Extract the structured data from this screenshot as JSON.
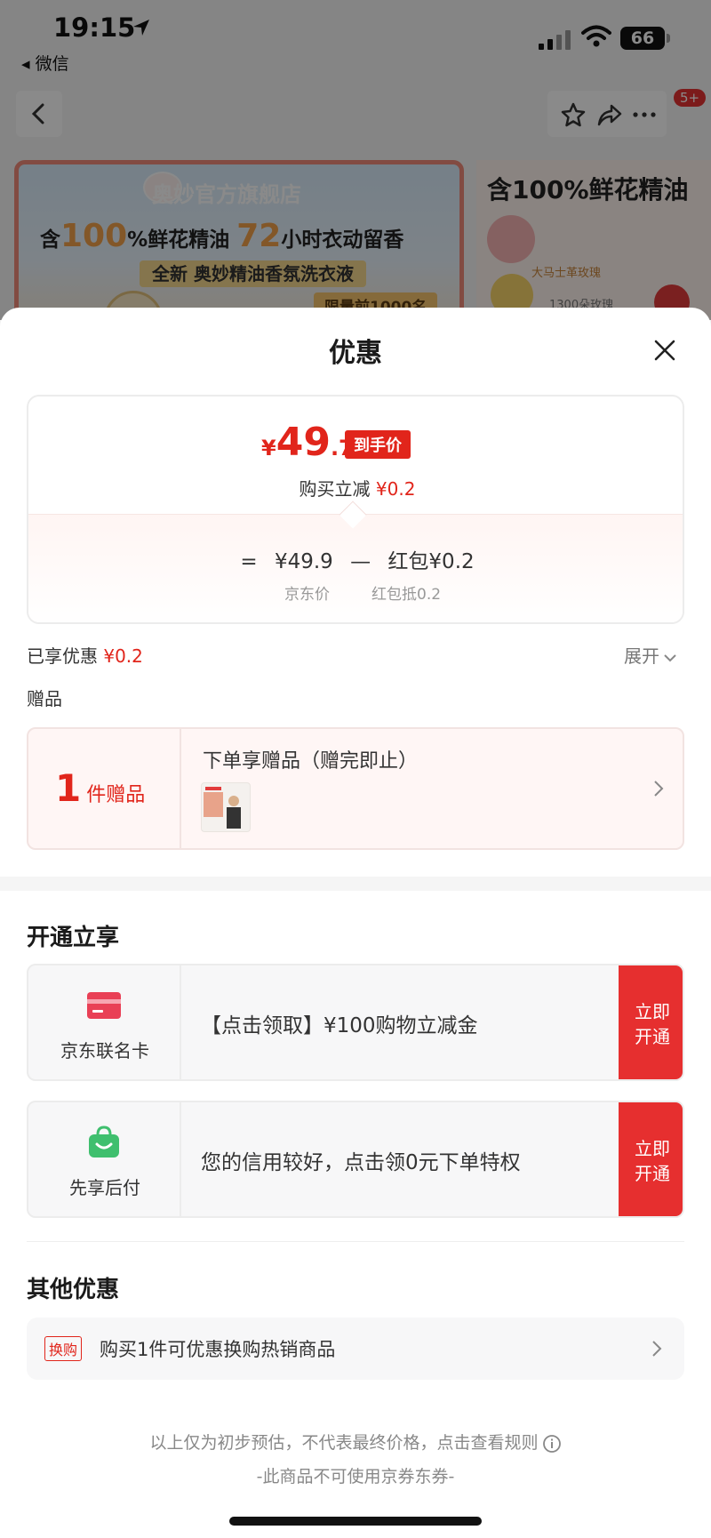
{
  "status_bar": {
    "time": "19:15",
    "back_app": "◂ 微信",
    "battery": "66"
  },
  "header": {
    "notification_badge": "5+"
  },
  "banner": {
    "brand": "奥妙官方旗舰店",
    "line1_prefix": "含",
    "line1_num": "100",
    "line1_mid": "%鲜花精油",
    "line1_num2": "72",
    "line1_suffix": "小时衣动留香",
    "line2": "全新 奥妙精油香氛洗衣液",
    "tag": "限量前1000名"
  },
  "side_card": {
    "title": "含100%鲜花精油",
    "sub": "大马士革玫瑰",
    "sub2": "1300朵玫瑰"
  },
  "sheet": {
    "title": "优惠",
    "price": {
      "symbol": "¥",
      "integer": "49",
      "decimal": ".7",
      "tag": "到手价",
      "reduce_label": "购买立减 ",
      "reduce_value": "¥0.2",
      "formula_eq": "=",
      "formula_base": "¥49.9",
      "formula_minus": "—",
      "formula_item": "红包¥0.2",
      "base_caption": "京东价",
      "item_caption": "红包抵0.2"
    },
    "enjoyed_label": "已享优惠 ",
    "enjoyed_value": "¥0.2",
    "expand_label": "展开",
    "gift_section_label": "赠品",
    "gift": {
      "count": "1",
      "unit": "件赠品",
      "title": "下单享赠品（赠完即止）"
    },
    "open_section_title": "开通立享",
    "offers": [
      {
        "name": "京东联名卡",
        "text": "【点击领取】¥100购物立减金",
        "button": "立即\n开通"
      },
      {
        "name": "先享后付",
        "text": "您的信用较好，点击领0元下单特权",
        "button": "立即\n开通"
      }
    ],
    "other_section_title": "其他优惠",
    "other": {
      "tag": "换购",
      "text": "购买1件可优惠换购热销商品"
    },
    "disclaimer": "以上仅为初步预估，不代表最终价格，点击查看规则",
    "no_coupon": "-此商品不可使用京券东券-"
  },
  "colors": {
    "accent_red": "#e1251b",
    "button_red": "#e62f2f",
    "card_bg": "#f7f7f8"
  },
  "icons": [
    "location-arrow-icon",
    "signal-icon",
    "wifi-icon",
    "back-chevron-icon",
    "star-icon",
    "share-icon",
    "more-icon",
    "close-icon",
    "chevron-down-icon",
    "chevron-right-icon",
    "card-icon",
    "shopping-bag-icon",
    "info-icon"
  ]
}
